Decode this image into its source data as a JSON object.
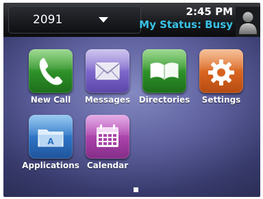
{
  "status_bar": {
    "line_number": "2091",
    "time": "2:45 PM",
    "status": "My Status: Busy"
  },
  "apps": [
    {
      "label": "New Call",
      "icon": "phone-handset-icon",
      "color": "#2d8f28"
    },
    {
      "label": "Messages",
      "icon": "envelope-icon",
      "color": "#7c64c9"
    },
    {
      "label": "Directories",
      "icon": "open-book-icon",
      "color": "#2d8f28"
    },
    {
      "label": "Settings",
      "icon": "gear-icon",
      "color": "#d7631f"
    },
    {
      "label": "Applications",
      "icon": "applications-folder-icon",
      "color": "#2d71c2"
    },
    {
      "label": "Calendar",
      "icon": "calendar-icon",
      "color": "#a841a8"
    }
  ],
  "pager": {
    "current_page": 1,
    "total_pages": 1
  },
  "colors": {
    "status_text": "#38c2e6",
    "background": "#5c5f9c"
  }
}
